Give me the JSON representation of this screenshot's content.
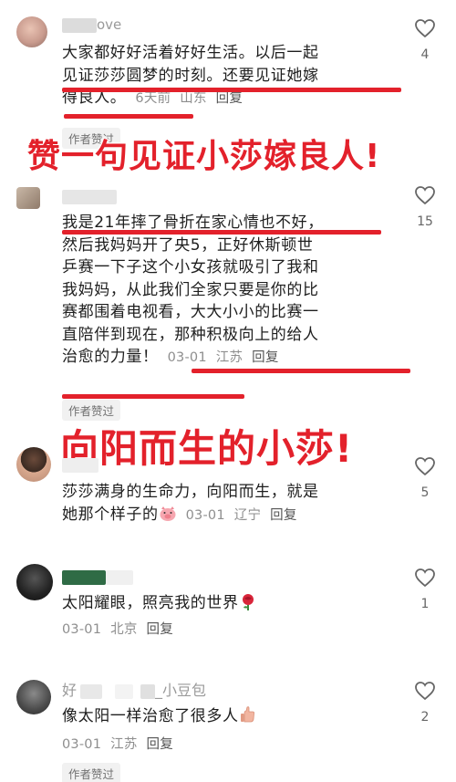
{
  "comments": [
    {
      "user": "ove",
      "text_lines": [
        "大家都好好活着好好生活。以后一起",
        "见证莎莎圆梦的时刻。还要见证她嫁",
        "得良人。"
      ],
      "time": "6天前",
      "location": "山东",
      "reply": "回复",
      "likes": "4",
      "author_liked": "作者赞过"
    },
    {
      "user": "",
      "text_lines": [
        "我是21年摔了骨折在家心情也不好，",
        "然后我妈妈开了央5，正好休斯顿世",
        "乒赛一下子这个小女孩就吸引了我和",
        "我妈妈，从此我们全家只要是你的比",
        "赛都围着电视看，大大小小的比赛一",
        "直陪伴到现在，那种积极向上的给人",
        "治愈的力量！"
      ],
      "time": "03-01",
      "location": "江苏",
      "reply": "回复",
      "likes": "15",
      "author_liked": "作者赞过"
    },
    {
      "user": "",
      "text_lines": [
        "莎莎满身的生命力，向阳而生，就是",
        "她那个样子的"
      ],
      "time": "03-01",
      "location": "辽宁",
      "reply": "回复",
      "likes": "5"
    },
    {
      "user": "",
      "text_lines": [
        "太阳耀眼，照亮我的世界"
      ],
      "time": "03-01",
      "location": "北京",
      "reply": "回复",
      "likes": "1"
    },
    {
      "user": "好",
      "user_suffix": "_小豆包",
      "text_lines": [
        "像太阳一样治愈了很多人"
      ],
      "time": "03-01",
      "location": "江苏",
      "reply": "回复",
      "likes": "2",
      "author_liked": "作者赞过"
    }
  ],
  "overlays": {
    "caption1": "赞一句见证小莎嫁良人!",
    "caption2": "向阳而生的小莎!"
  },
  "colors": {
    "highlight_red": "#e3212b",
    "meta_gray": "#8e8e8e"
  },
  "icons": {
    "like": "heart-outline-icon",
    "emoji_pig": "pig-emoji-icon",
    "emoji_rose": "rose-emoji-icon",
    "emoji_hand": "hand-emoji-icon"
  }
}
